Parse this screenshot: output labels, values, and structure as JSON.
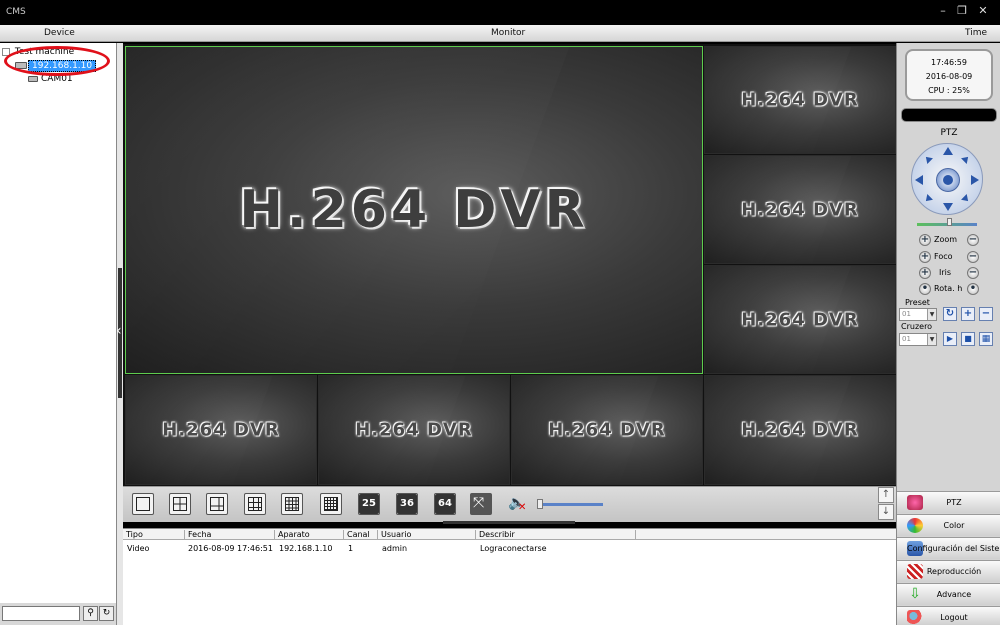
{
  "window": {
    "title": "CMS"
  },
  "columns": {
    "device": "Device",
    "monitor": "Monitor",
    "time": "Time"
  },
  "device_tree": {
    "root": "Test machine",
    "device_ip": "192.168.1.10",
    "channel": "CAM01"
  },
  "monitor": {
    "tiles": [
      {
        "label": "H.264 DVR",
        "active": true
      },
      {
        "label": "H.264 DVR"
      },
      {
        "label": "H.264 DVR"
      },
      {
        "label": "H.264 DVR"
      },
      {
        "label": "H.264 DVR"
      },
      {
        "label": "H.264 DVR"
      },
      {
        "label": "H.264 DVR"
      },
      {
        "label": "H.264 DVR"
      }
    ]
  },
  "toolbar": {
    "layout_numbers": [
      "25",
      "36",
      "64"
    ],
    "scroll_up": "↑",
    "scroll_down": "↓"
  },
  "log": {
    "columns": [
      "Tipo",
      "Fecha",
      "Aparato",
      "Canal",
      "Usuario",
      "Describir"
    ],
    "rows": [
      {
        "tipo": "Video",
        "fecha": "2016-08-09 17:46:51",
        "aparato": "192.168.1.10",
        "canal": "1",
        "usuario": "admin",
        "describir": "Lograconectarse"
      }
    ]
  },
  "time_panel": {
    "time": "17:46:59",
    "date": "2016-08-09",
    "cpu": "CPU : 25%"
  },
  "ptz": {
    "title": "PTZ",
    "zoom": "Zoom",
    "focus": "Foco",
    "iris": "Iris",
    "rotate": "Rota. h",
    "preset_label": "Preset",
    "preset_value": "01",
    "cruise_label": "Cruzero",
    "cruise_value": "01"
  },
  "menu": {
    "ptz": "PTZ",
    "color": "Color",
    "config": "Configuración del Sistema",
    "playback": "Reproducción",
    "advance": "Advance",
    "logout": "Logout"
  },
  "colors": {
    "active_tile_border": "#5ecc4e",
    "selection_blue": "#3399ff",
    "highlight_ellipse": "#e0101a"
  }
}
